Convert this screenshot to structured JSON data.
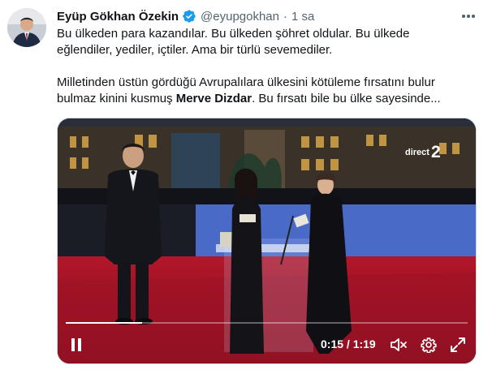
{
  "author": {
    "name": "Eyüp Gökhan Özekin",
    "handle": "@eyupgokhan",
    "separator": "·",
    "time": "1 sa",
    "verified_icon": "verified-badge-icon",
    "verified_color": "#1d9bf0"
  },
  "tweet": {
    "line1": "Bu ülkeden para kazandılar. Bu ülkeden şöhret oldular. Bu ülkede",
    "line2": "eğlendiler, yediler, içtiler. Ama bir türlü sevemediler.",
    "line3": "Milletinden üstün gördüğü Avrupalılara ülkesini kötüleme fırsatını bulur",
    "line4_before": "bulmaz kinini kusmuş ",
    "line4_bold": "Merve Dizdar",
    "line4_after": ". Bu fırsatı bile bu ülke sayesinde..."
  },
  "video": {
    "channel_word": "direct",
    "channel_number": "2",
    "timecode": "0:15 / 1:19",
    "progress": 0.19,
    "controls": [
      "pause-icon",
      "volume-muted-icon",
      "settings-gear-icon",
      "fullscreen-icon"
    ]
  },
  "colors": {
    "text_primary": "#0f1419",
    "text_secondary": "#536471",
    "stage_red": "#b01b2c",
    "stage_blue": "#3f5fc0"
  }
}
